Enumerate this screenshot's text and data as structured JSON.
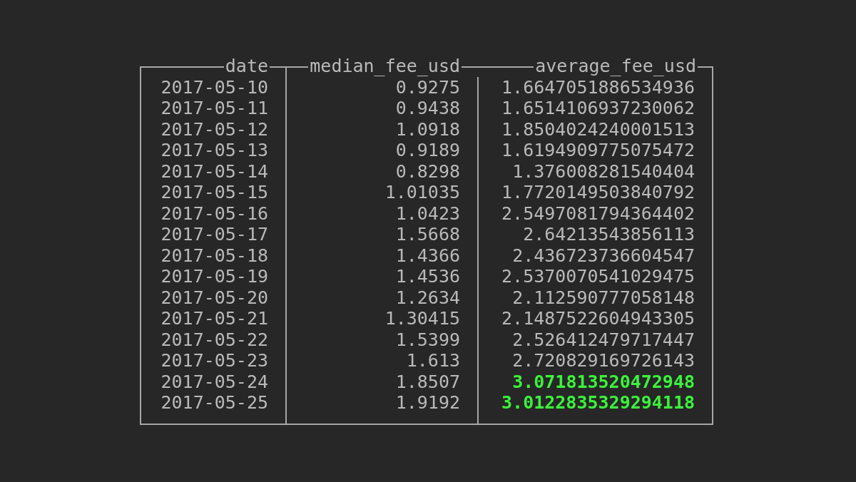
{
  "table": {
    "columns": [
      "date",
      "median_fee_usd",
      "average_fee_usd"
    ],
    "rows": [
      {
        "cells": [
          "2017-05-10",
          "0.9275",
          "1.6647051886534936"
        ],
        "highlighted": false
      },
      {
        "cells": [
          "2017-05-11",
          "0.9438",
          "1.6514106937230062"
        ],
        "highlighted": false
      },
      {
        "cells": [
          "2017-05-12",
          "1.0918",
          "1.8504024240001513"
        ],
        "highlighted": false
      },
      {
        "cells": [
          "2017-05-13",
          "0.9189",
          "1.6194909775075472"
        ],
        "highlighted": false
      },
      {
        "cells": [
          "2017-05-14",
          "0.8298",
          "1.376008281540404"
        ],
        "highlighted": false
      },
      {
        "cells": [
          "2017-05-15",
          "1.01035",
          "1.7720149503840792"
        ],
        "highlighted": false
      },
      {
        "cells": [
          "2017-05-16",
          "1.0423",
          "2.5497081794364402"
        ],
        "highlighted": false
      },
      {
        "cells": [
          "2017-05-17",
          "1.5668",
          "2.64213543856113"
        ],
        "highlighted": false
      },
      {
        "cells": [
          "2017-05-18",
          "1.4366",
          "2.436723736604547"
        ],
        "highlighted": false
      },
      {
        "cells": [
          "2017-05-19",
          "1.4536",
          "2.5370070541029475"
        ],
        "highlighted": false
      },
      {
        "cells": [
          "2017-05-20",
          "1.2634",
          "2.112590777058148"
        ],
        "highlighted": false
      },
      {
        "cells": [
          "2017-05-21",
          "1.30415",
          "2.1487522604943305"
        ],
        "highlighted": false
      },
      {
        "cells": [
          "2017-05-22",
          "1.5399",
          "2.526412479717447"
        ],
        "highlighted": false
      },
      {
        "cells": [
          "2017-05-23",
          "1.613",
          "2.720829169726143"
        ],
        "highlighted": false
      },
      {
        "cells": [
          "2017-05-24",
          "1.8507",
          "3.071813520472948"
        ],
        "highlighted": true
      },
      {
        "cells": [
          "2017-05-25",
          "1.9192",
          "3.0122835329294118"
        ],
        "highlighted": true
      }
    ]
  }
}
